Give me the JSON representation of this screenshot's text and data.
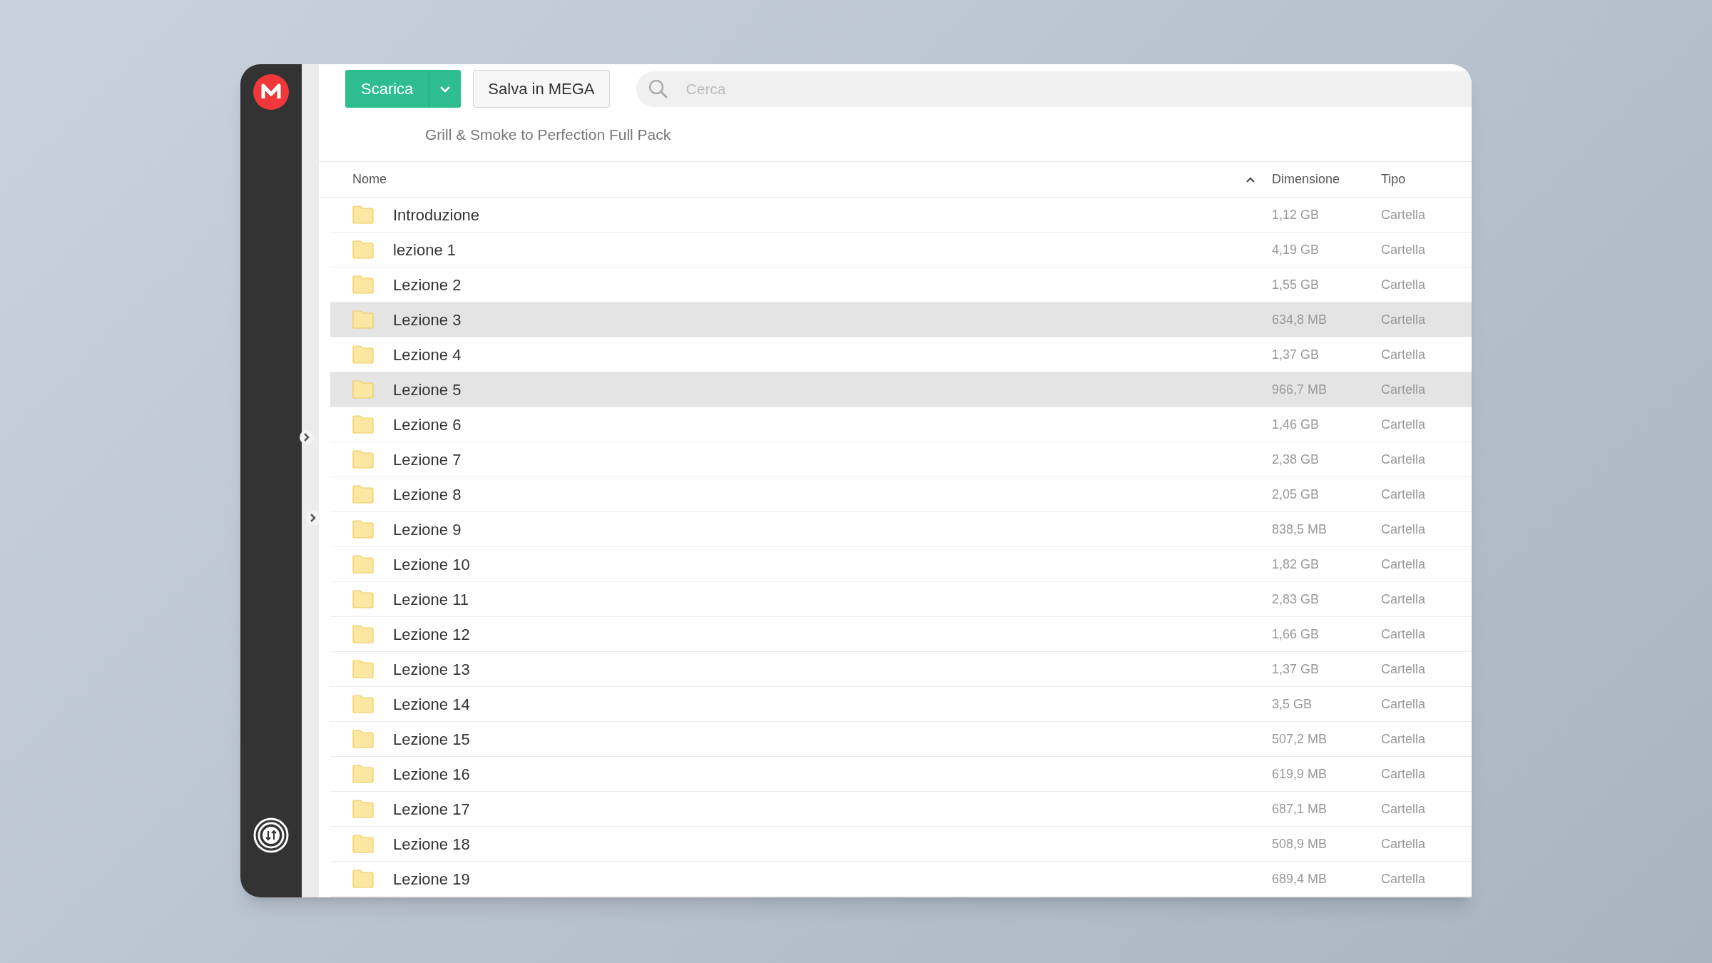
{
  "toolbar": {
    "download_button": "Scarica",
    "save_button": "Salva in MEGA",
    "search": {
      "placeholder": "Cerca"
    }
  },
  "folder_title": "Grill & Smoke to Perfection Full Pack",
  "table": {
    "columns": [
      "Nome",
      "Dimensione",
      "Tipo"
    ],
    "rows": [
      {
        "name": "Introduzione",
        "size": "1,12 GB",
        "type": "Cartella",
        "highlighted": false
      },
      {
        "name": "lezione 1",
        "size": "4,19 GB",
        "type": "Cartella",
        "highlighted": false
      },
      {
        "name": "Lezione 2",
        "size": "1,55 GB",
        "type": "Cartella",
        "highlighted": false
      },
      {
        "name": "Lezione 3",
        "size": "634,8 MB",
        "type": "Cartella",
        "highlighted": true
      },
      {
        "name": "Lezione 4",
        "size": "1,37 GB",
        "type": "Cartella",
        "highlighted": false
      },
      {
        "name": "Lezione 5",
        "size": "966,7 MB",
        "type": "Cartella",
        "highlighted": true
      },
      {
        "name": "Lezione 6",
        "size": "1,46 GB",
        "type": "Cartella",
        "highlighted": false
      },
      {
        "name": "Lezione 7",
        "size": "2,38 GB",
        "type": "Cartella",
        "highlighted": false
      },
      {
        "name": "Lezione 8",
        "size": "2,05 GB",
        "type": "Cartella",
        "highlighted": false
      },
      {
        "name": "Lezione 9",
        "size": "838,5 MB",
        "type": "Cartella",
        "highlighted": false
      },
      {
        "name": "Lezione 10",
        "size": "1,82 GB",
        "type": "Cartella",
        "highlighted": false
      },
      {
        "name": "Lezione 11",
        "size": "2,83 GB",
        "type": "Cartella",
        "highlighted": false
      },
      {
        "name": "Lezione 12",
        "size": "1,66 GB",
        "type": "Cartella",
        "highlighted": false
      },
      {
        "name": "Lezione 13",
        "size": "1,37 GB",
        "type": "Cartella",
        "highlighted": false
      },
      {
        "name": "Lezione 14",
        "size": "3,5 GB",
        "type": "Cartella",
        "highlighted": false
      },
      {
        "name": "Lezione 15",
        "size": "507,2 MB",
        "type": "Cartella",
        "highlighted": false
      },
      {
        "name": "Lezione 16",
        "size": "619,9 MB",
        "type": "Cartella",
        "highlighted": false
      },
      {
        "name": "Lezione 17",
        "size": "687,1 MB",
        "type": "Cartella",
        "highlighted": false
      },
      {
        "name": "Lezione 18",
        "size": "508,9 MB",
        "type": "Cartella",
        "highlighted": false
      },
      {
        "name": "Lezione 19",
        "size": "689,4 MB",
        "type": "Cartella",
        "highlighted": false
      }
    ]
  }
}
